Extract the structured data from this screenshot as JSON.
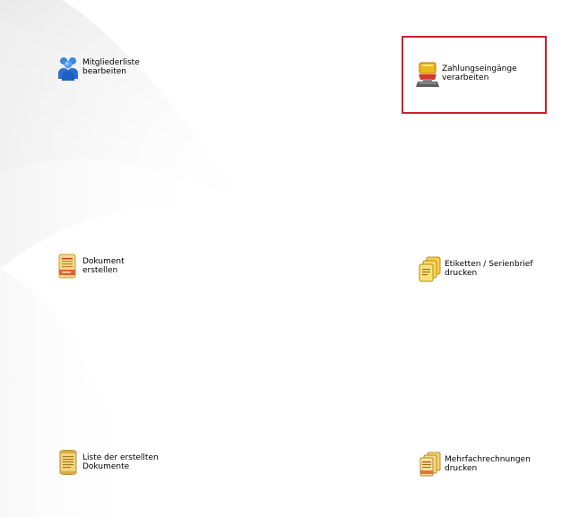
{
  "tiles": [
    {
      "id": "mitglieder",
      "line1": "Mitgliederliste",
      "line2": "bearbeiten",
      "icon": "users-group-icon"
    },
    {
      "id": "zahlungen",
      "line1": "Zahlungseingänge",
      "line2": "verarbeiten",
      "icon": "payment-stamp-icon"
    },
    {
      "id": "dokument",
      "line1": "Dokument",
      "line2": "erstellen",
      "icon": "document-create-icon"
    },
    {
      "id": "etiketten",
      "line1": "Etiketten / Serienbrief",
      "line2": "drucken",
      "icon": "labels-serial-letter-icon"
    },
    {
      "id": "liste",
      "line1": "Liste der erstellten",
      "line2": "Dokumente",
      "icon": "document-list-icon"
    },
    {
      "id": "rechnungen",
      "line1": "Mehrfachrechnungen",
      "line2": "drucken",
      "icon": "multi-invoice-icon"
    }
  ],
  "colors": {
    "highlight": "#c8202e",
    "users_blue": "#2a6fd1",
    "paper": "#f3d98a",
    "paper_edge": "#c99a2e"
  }
}
